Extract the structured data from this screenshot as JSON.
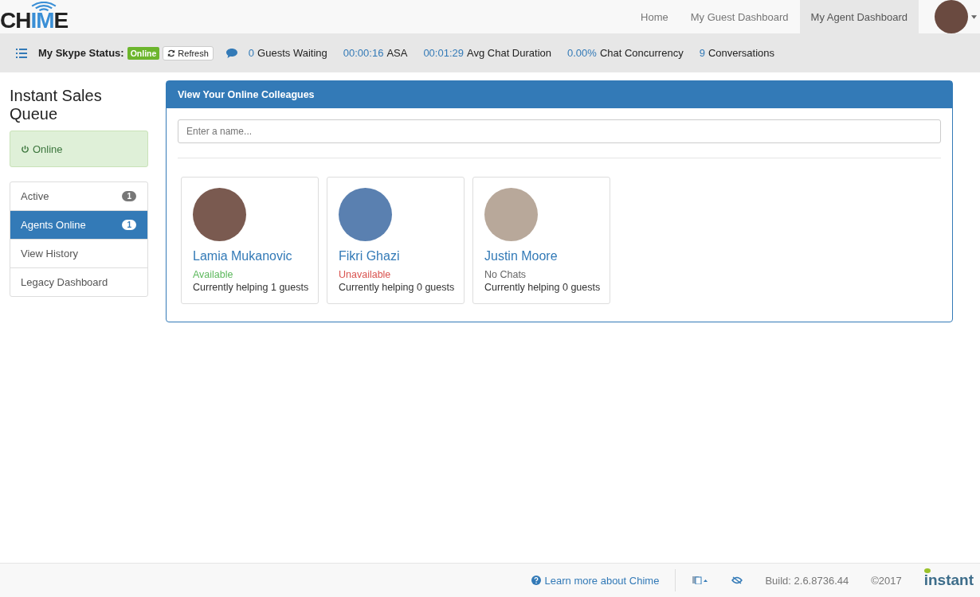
{
  "logo": [
    {
      "text": "CH",
      "accent": false
    },
    {
      "text": "IM",
      "accent": true
    },
    {
      "text": "E",
      "accent": false
    }
  ],
  "nav": [
    {
      "label": "Home",
      "selected": false
    },
    {
      "label": "My Guest Dashboard",
      "selected": false
    },
    {
      "label": "My Agent Dashboard",
      "selected": true
    }
  ],
  "toolbar": {
    "skype_label": "My Skype Status:",
    "skype_status": "Online",
    "refresh": "Refresh",
    "stats": [
      {
        "figure": "0",
        "caption": "Guests Waiting"
      },
      {
        "figure": "00:00:16",
        "caption": "ASA"
      },
      {
        "figure": "00:01:29",
        "caption": "Avg Chat Duration"
      },
      {
        "figure": "0.00%",
        "caption": "Chat Concurrency"
      },
      {
        "figure": "9",
        "caption": "Conversations"
      }
    ]
  },
  "sidebar": {
    "title": "Instant Sales Queue",
    "status": "Online",
    "items": [
      {
        "label": "Active",
        "badge": "1",
        "selected": false
      },
      {
        "label": "Agents Online",
        "badge": "1",
        "selected": true
      },
      {
        "label": "View History",
        "selected": false
      },
      {
        "label": "Legacy Dashboard",
        "selected": false
      }
    ]
  },
  "panel": {
    "title": "View Your Online Colleagues",
    "search": {
      "placeholder": "Enter a name..."
    },
    "agents": [
      {
        "name": "Lamia Mukanovic",
        "status": "Available",
        "kind": "available",
        "helping": "Currently helping 1 guests"
      },
      {
        "name": "Fikri Ghazi",
        "status": "Unavailable",
        "kind": "unavailable",
        "helping": "Currently helping 0 guests"
      },
      {
        "name": "Justin Moore",
        "status": "No Chats",
        "kind": "idle",
        "helping": "Currently helping 0 guests"
      }
    ]
  },
  "footer": {
    "learn": "Learn more about Chime",
    "build": "Build: 2.6.8736.44",
    "copyright": "©2017",
    "brand": "instant"
  }
}
